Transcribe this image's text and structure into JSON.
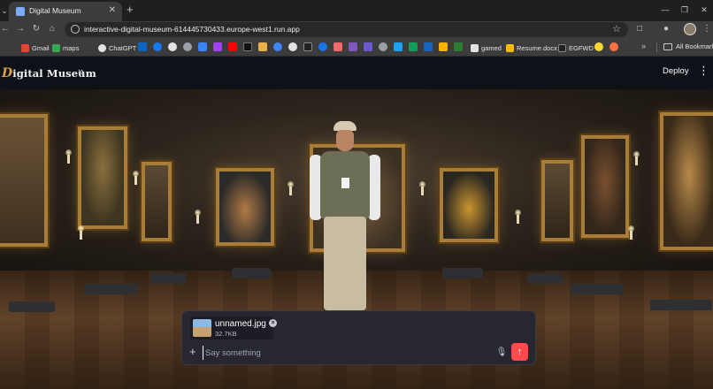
{
  "browser": {
    "tab_title": "Digital Museum",
    "url": "interactive-digital-museum-614445730433.europe-west1.run.app",
    "bookmarks": [
      "Gmail",
      "maps",
      "ChatGPT",
      "gamed",
      "Resume.docx",
      "EGFWD"
    ],
    "all_bookmarks_label": "All Bookmarks"
  },
  "app": {
    "logo_initial": "D",
    "logo_rest": "igital Museum",
    "deploy_label": "Deploy"
  },
  "chat": {
    "attachment": {
      "name": "unnamed.jpg",
      "size": "32.7KB"
    },
    "placeholder": "Say something",
    "value": ""
  },
  "colors": {
    "accent": "#ff4b4b",
    "header_bg": "#0e1117",
    "chat_bg": "#262730",
    "frame_gold": "#a77d38"
  },
  "icons": {
    "send": "arrow-up-icon",
    "mic": "microphone-icon",
    "add": "plus-icon"
  }
}
